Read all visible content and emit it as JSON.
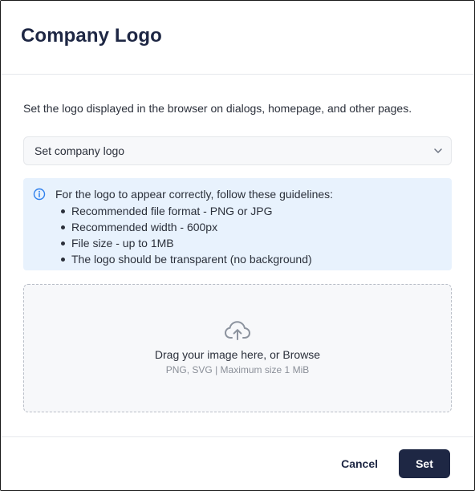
{
  "dialog": {
    "title": "Company Logo",
    "description": "Set the logo displayed in the browser on dialogs, homepage, and other pages."
  },
  "select": {
    "value": "Set company logo",
    "icon": "chevron-down-icon"
  },
  "info": {
    "icon": "info-icon",
    "heading": "For the logo to appear correctly, follow these guidelines:",
    "items": [
      "Recommended file format - PNG or JPG",
      "Recommended width - 600px",
      "File size - up to 1MB",
      "The logo should be transparent (no background)"
    ]
  },
  "dropzone": {
    "icon": "cloud-upload-icon",
    "title": "Drag your image here, or Browse",
    "subtitle": "PNG, SVG | Maximum size 1 MiB"
  },
  "footer": {
    "cancel_label": "Cancel",
    "set_label": "Set"
  },
  "colors": {
    "primary": "#1e2744",
    "info_background": "#e8f2fd",
    "info_icon": "#2f80ed",
    "dropzone_background": "#f7f8fa"
  }
}
